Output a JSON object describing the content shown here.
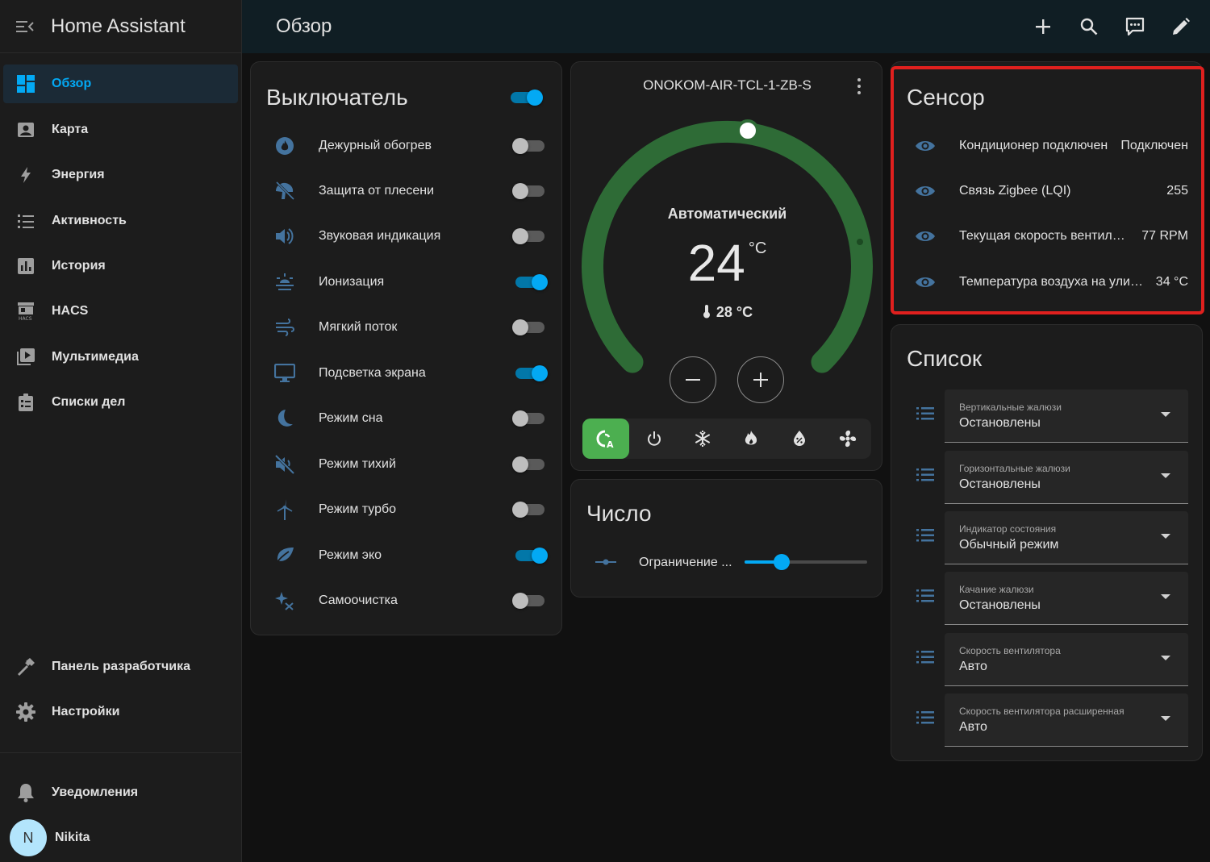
{
  "app": {
    "title": "Home Assistant"
  },
  "sidebar": {
    "items": [
      {
        "label": "Обзор",
        "icon": "view-dashboard-icon"
      },
      {
        "label": "Карта",
        "icon": "map-icon"
      },
      {
        "label": "Энергия",
        "icon": "lightning-bolt-icon"
      },
      {
        "label": "Активность",
        "icon": "format-list-bulleted-icon"
      },
      {
        "label": "История",
        "icon": "chart-box-icon"
      },
      {
        "label": "HACS",
        "icon": "hacs-icon"
      },
      {
        "label": "Мультимедиа",
        "icon": "play-box-multiple-icon"
      },
      {
        "label": "Списки дел",
        "icon": "clipboard-list-icon"
      }
    ],
    "developer": "Панель разработчика",
    "settings": "Настройки",
    "notifications": "Уведомления",
    "user": {
      "name": "Nikita",
      "initial": "N"
    }
  },
  "header": {
    "title": "Обзор"
  },
  "switch_card": {
    "title": "Выключатель",
    "master_on": true,
    "items": [
      {
        "label": "Дежурный обогрев",
        "on": false,
        "icon": "fire-circle-icon"
      },
      {
        "label": "Защита от плесени",
        "on": false,
        "icon": "mold-protection-icon"
      },
      {
        "label": "Звуковая индикация",
        "on": false,
        "icon": "volume-high-icon"
      },
      {
        "label": "Ионизация",
        "on": true,
        "icon": "ionizer-icon"
      },
      {
        "label": "Мягкий поток",
        "on": false,
        "icon": "weather-windy-icon"
      },
      {
        "label": "Подсветка экрана",
        "on": true,
        "icon": "monitor-icon"
      },
      {
        "label": "Режим сна",
        "on": false,
        "icon": "moon-icon"
      },
      {
        "label": "Режим тихий",
        "on": false,
        "icon": "volume-off-icon"
      },
      {
        "label": "Режим турбо",
        "on": false,
        "icon": "wind-turbine-icon"
      },
      {
        "label": "Режим эко",
        "on": true,
        "icon": "leaf-icon"
      },
      {
        "label": "Самоочистка",
        "on": false,
        "icon": "sparkles-icon"
      }
    ]
  },
  "thermostat": {
    "name": "ONOKOM-AIR-TCL-1-ZB-S",
    "mode": "Автоматический",
    "target": "24",
    "unit": "°C",
    "current": "28 °C",
    "modes": [
      {
        "icon": "thermostat-auto-icon",
        "active": true
      },
      {
        "icon": "power-icon",
        "active": false
      },
      {
        "icon": "snowflake-icon",
        "active": false
      },
      {
        "icon": "fire-icon",
        "active": false
      },
      {
        "icon": "water-percent-icon",
        "active": false
      },
      {
        "icon": "fan-icon",
        "active": false
      }
    ]
  },
  "number_card": {
    "title": "Число",
    "label": "Ограничение ...",
    "value_fraction": 0.3
  },
  "sensor_card": {
    "title": "Сенсор",
    "items": [
      {
        "label": "Кондиционер подключен",
        "value": "Подключен"
      },
      {
        "label": "Связь Zigbee (LQI)",
        "value": "255"
      },
      {
        "label": "Текущая скорость вентилятора",
        "value": "77 RPM"
      },
      {
        "label": "Температура воздуха на улице",
        "value": "34 °C"
      }
    ]
  },
  "list_card": {
    "title": "Список",
    "items": [
      {
        "label": "Вертикальные жалюзи",
        "value": "Остановлены"
      },
      {
        "label": "Горизонтальные жалюзи",
        "value": "Остановлены"
      },
      {
        "label": "Индикатор состояния",
        "value": "Обычный режим"
      },
      {
        "label": "Качание жалюзи",
        "value": "Остановлены"
      },
      {
        "label": "Скорость вентилятора",
        "value": "Авто"
      },
      {
        "label": "Скорость вентилятора расширенная",
        "value": "Авто"
      }
    ]
  },
  "colors": {
    "accent": "#03a9f4",
    "gauge": "#2e6b36",
    "active_mode": "#4caf50",
    "highlight": "#e0201e"
  }
}
